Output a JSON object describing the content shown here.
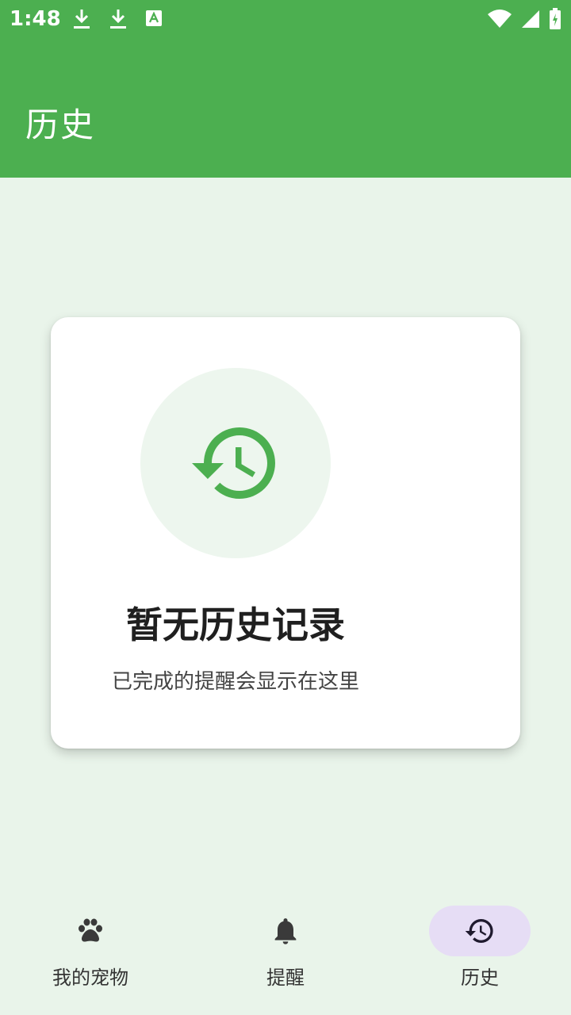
{
  "status_bar": {
    "time": "1:48",
    "icons": [
      "download-icon",
      "download-icon",
      "keyboard-a-icon",
      "wifi-icon",
      "cellular-signal-icon",
      "battery-charging-icon"
    ]
  },
  "app_bar": {
    "title": "历史"
  },
  "empty_state": {
    "icon": "history-icon",
    "title": "暂无历史记录",
    "subtitle": "已完成的提醒会显示在这里"
  },
  "bottom_nav": {
    "items": [
      {
        "label": "我的宠物",
        "icon": "paw-icon",
        "active": false
      },
      {
        "label": "提醒",
        "icon": "bell-icon",
        "active": false
      },
      {
        "label": "历史",
        "icon": "history-icon",
        "active": true
      }
    ]
  },
  "colors": {
    "primary": "#4CAF50",
    "background": "#E9F4EA",
    "card": "#FFFFFF",
    "nav_active_indicator": "#E6DDF5",
    "text_primary": "#1F1F1F",
    "text_secondary": "#444444"
  }
}
